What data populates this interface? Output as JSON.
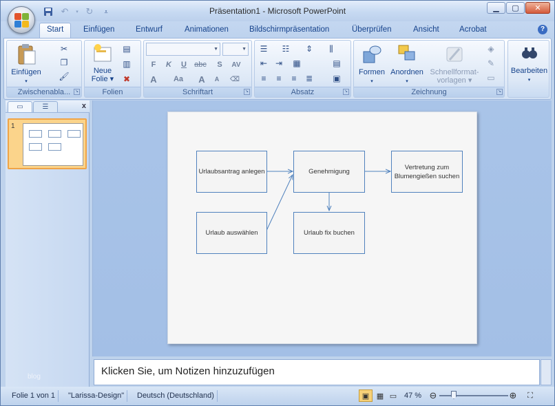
{
  "window": {
    "title": "Präsentation1 - Microsoft PowerPoint"
  },
  "ribbon_tabs": [
    "Start",
    "Einfügen",
    "Entwurf",
    "Animationen",
    "Bildschirmpräsentation",
    "Überprüfen",
    "Ansicht",
    "Acrobat"
  ],
  "groups": {
    "clipboard": {
      "label": "Zwischenabla...",
      "paste": "Einfügen"
    },
    "slides": {
      "label": "Folien",
      "new_slide_1": "Neue",
      "new_slide_2": "Folie"
    },
    "font": {
      "label": "Schriftart",
      "bold": "F",
      "italic": "K",
      "underline": "U",
      "strike": "abc",
      "shadow": "S",
      "spacing": "AV",
      "case": "Aa",
      "grow": "A",
      "shrink": "A"
    },
    "paragraph": {
      "label": "Absatz"
    },
    "drawing": {
      "label": "Zeichnung",
      "shapes": "Formen",
      "arrange": "Anordnen",
      "quick_styles_1": "Schnellformat-",
      "quick_styles_2": "vorlagen"
    },
    "editing": {
      "label": "Bearbeiten"
    }
  },
  "pane": {
    "slide_number": "1",
    "close": "x",
    "footer": "blog"
  },
  "slide": {
    "boxes": {
      "apply": "Urlaubsantrag anlegen",
      "approval": "Genehmigung",
      "substitute": "Vertretung zum Blumengießen suchen",
      "choose": "Urlaub auswählen",
      "book": "Urlaub fix buchen"
    }
  },
  "notes": {
    "placeholder": "Klicken Sie, um  Notizen hinzuzufügen"
  },
  "status": {
    "slide": "Folie 1 von 1",
    "theme": "\"Larissa-Design\"",
    "language": "Deutsch (Deutschland)",
    "zoom": "47 %",
    "zoom_level_percent": 47
  },
  "colors": {
    "accent": "#4f81bd",
    "thumb_selected": "#f0a447"
  }
}
